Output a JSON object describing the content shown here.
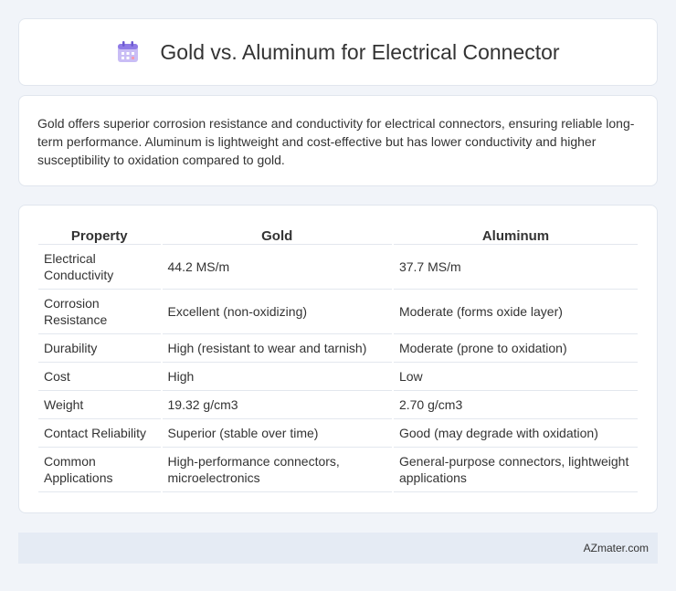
{
  "header": {
    "title": "Gold vs. Aluminum for Electrical Connector",
    "icon": "calendar-icon"
  },
  "summary": {
    "text": "Gold offers superior corrosion resistance and conductivity for electrical connectors, ensuring reliable long-term performance. Aluminum is lightweight and cost-effective but has lower conductivity and higher susceptibility to oxidation compared to gold."
  },
  "table": {
    "headers": [
      "Property",
      "Gold",
      "Aluminum"
    ],
    "rows": [
      [
        "Electrical Conductivity",
        "44.2 MS/m",
        "37.7 MS/m"
      ],
      [
        "Corrosion Resistance",
        "Excellent (non-oxidizing)",
        "Moderate (forms oxide layer)"
      ],
      [
        "Durability",
        "High (resistant to wear and tarnish)",
        "Moderate (prone to oxidation)"
      ],
      [
        "Cost",
        "High",
        "Low"
      ],
      [
        "Weight",
        "19.32 g/cm3",
        "2.70 g/cm3"
      ],
      [
        "Contact Reliability",
        "Superior (stable over time)",
        "Good (may degrade with oxidation)"
      ],
      [
        "Common Applications",
        "High-performance connectors, microelectronics",
        "General-purpose connectors, lightweight applications"
      ]
    ]
  },
  "footer": {
    "text": "AZmater.com"
  },
  "colors": {
    "background": "#f1f4f9",
    "card": "#ffffff",
    "footer_bg": "#e5ebf4",
    "icon_purple": "#b9a9f0"
  }
}
